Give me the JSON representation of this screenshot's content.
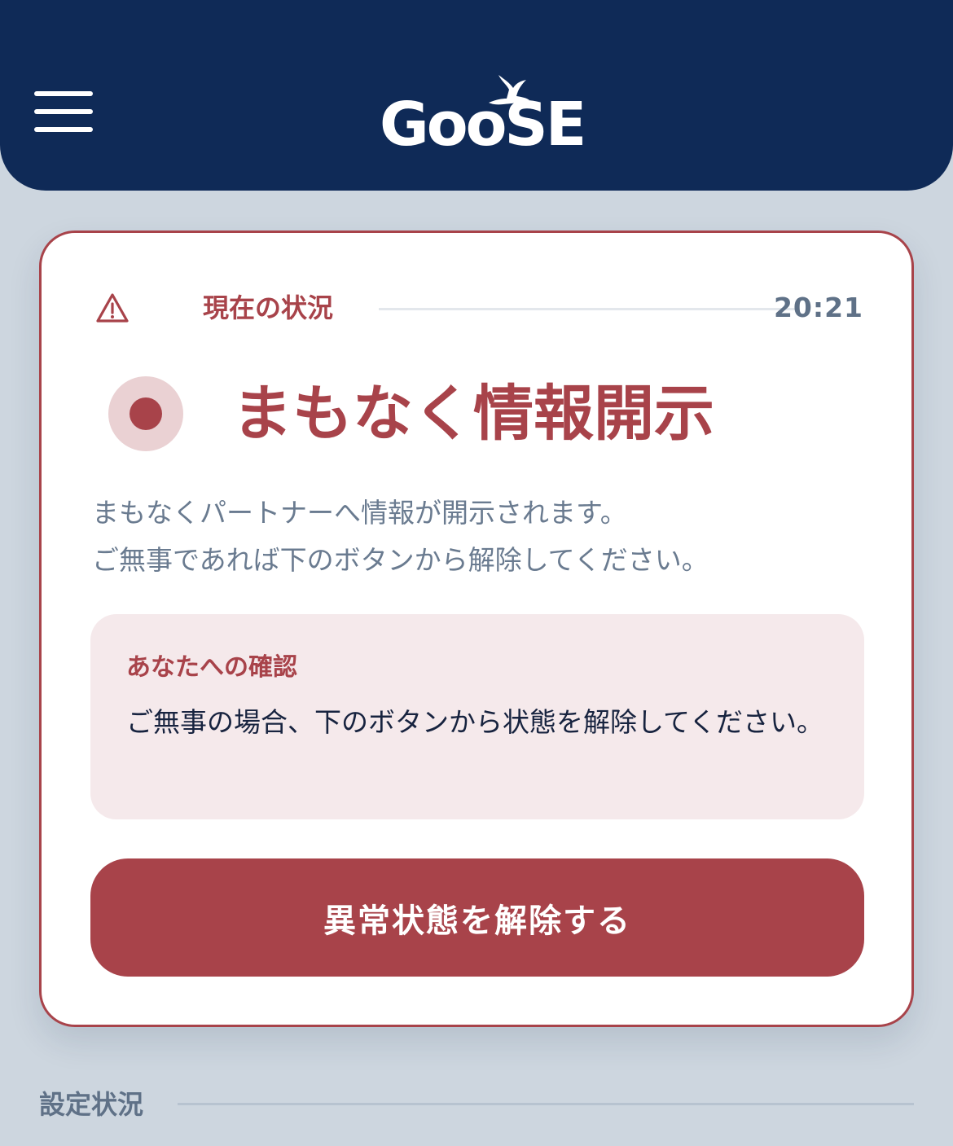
{
  "header": {
    "menu_icon": "hamburger-menu-icon",
    "logo_text": "GooSE",
    "logo_icon": "flying-goose-icon",
    "background": "#0f2a57"
  },
  "status_card": {
    "warning_icon": "warning-triangle-icon",
    "section_label": "現在の状況",
    "time": "20:21",
    "alert_indicator_icon": "alert-dot-icon",
    "title": "まもなく情報開示",
    "description_lines": [
      "まもなくパートナーへ情報が開示されます。",
      "ご無事であれば下のボタンから解除してください。"
    ],
    "confirmation": {
      "title": "あなたへの確認",
      "body": "ご無事の場合、下のボタンから状態を解除してください。"
    },
    "release_button_label": "異常状態を解除する",
    "accent_color": "#a8434a"
  },
  "settings": {
    "section_label": "設定状況"
  }
}
